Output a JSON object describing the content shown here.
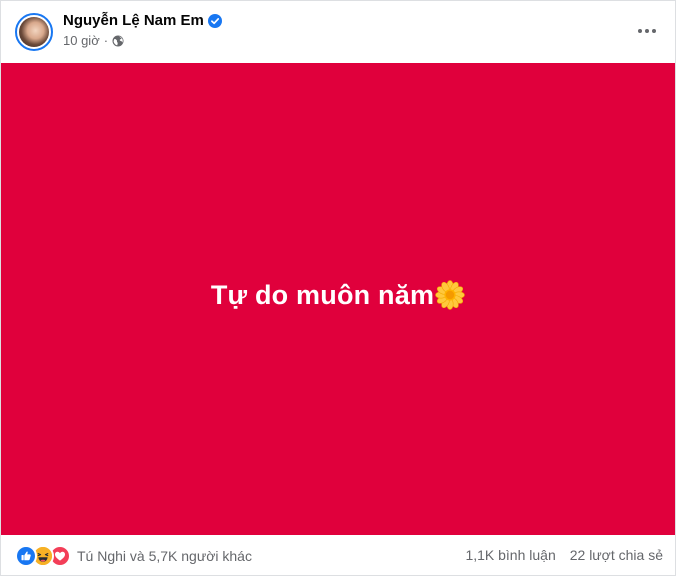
{
  "post": {
    "author_name": "Nguyễn Lệ Nam Em",
    "timestamp": "10 giờ",
    "status_text": "Tự do muôn năm",
    "background_color": "#e0003c",
    "text_color": "#ffffff",
    "icons": {
      "verified": "verified-badge-icon",
      "audience": "globe-icon",
      "emoji": "sunflower-icon",
      "menu": "more-options-icon"
    }
  },
  "footer": {
    "reactions": [
      "like",
      "haha",
      "love"
    ],
    "reactors_text": "Tú Nghi và 5,7K người khác",
    "comments_text": "1,1K bình luận",
    "shares_text": "22 lượt chia sẻ"
  }
}
